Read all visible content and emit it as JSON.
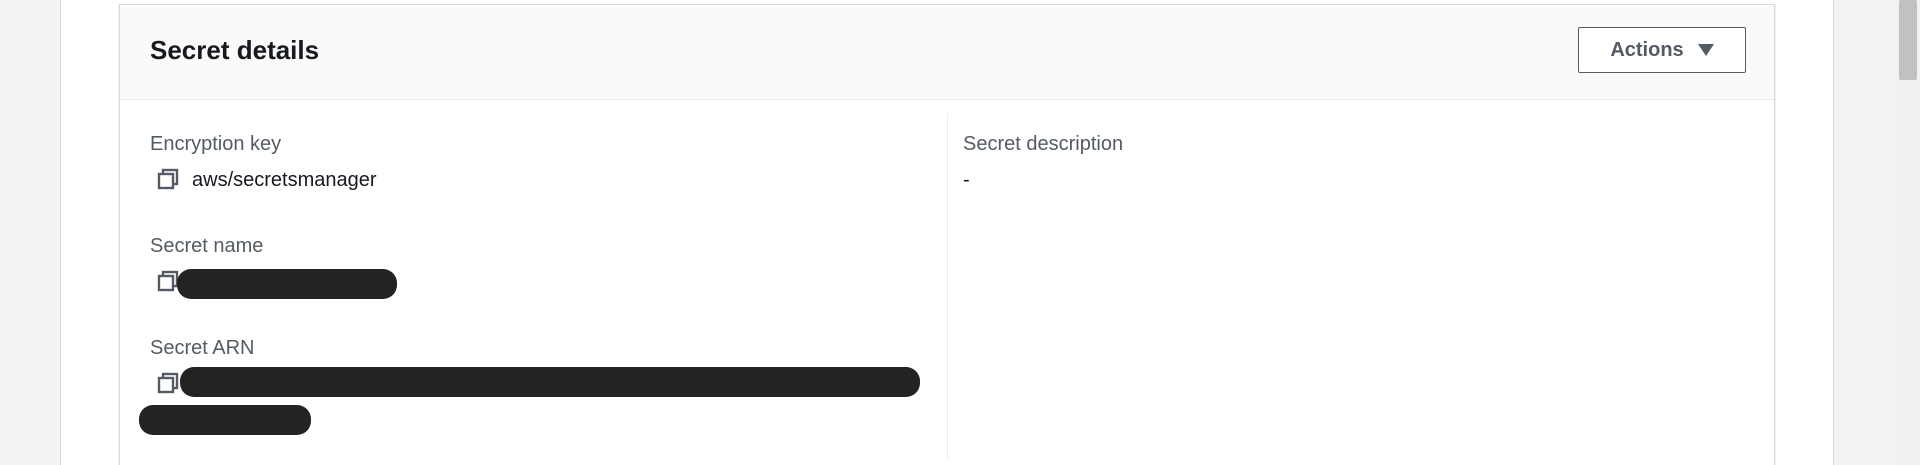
{
  "card": {
    "title": "Secret details",
    "actions_label": "Actions"
  },
  "left_column": {
    "encryption_key": {
      "label": "Encryption key",
      "value": "aws/secretsmanager"
    },
    "secret_name": {
      "label": "Secret name"
    },
    "secret_arn": {
      "label": "Secret ARN"
    }
  },
  "right_column": {
    "secret_description": {
      "label": "Secret description",
      "value": "-"
    }
  },
  "icons": {
    "copy": "copy-icon",
    "actions_caret": "caret-down-icon"
  },
  "colors": {
    "label_text": "#545b64",
    "value_text": "#16191f",
    "redaction": "#232323",
    "header_bg": "#fafafa"
  }
}
